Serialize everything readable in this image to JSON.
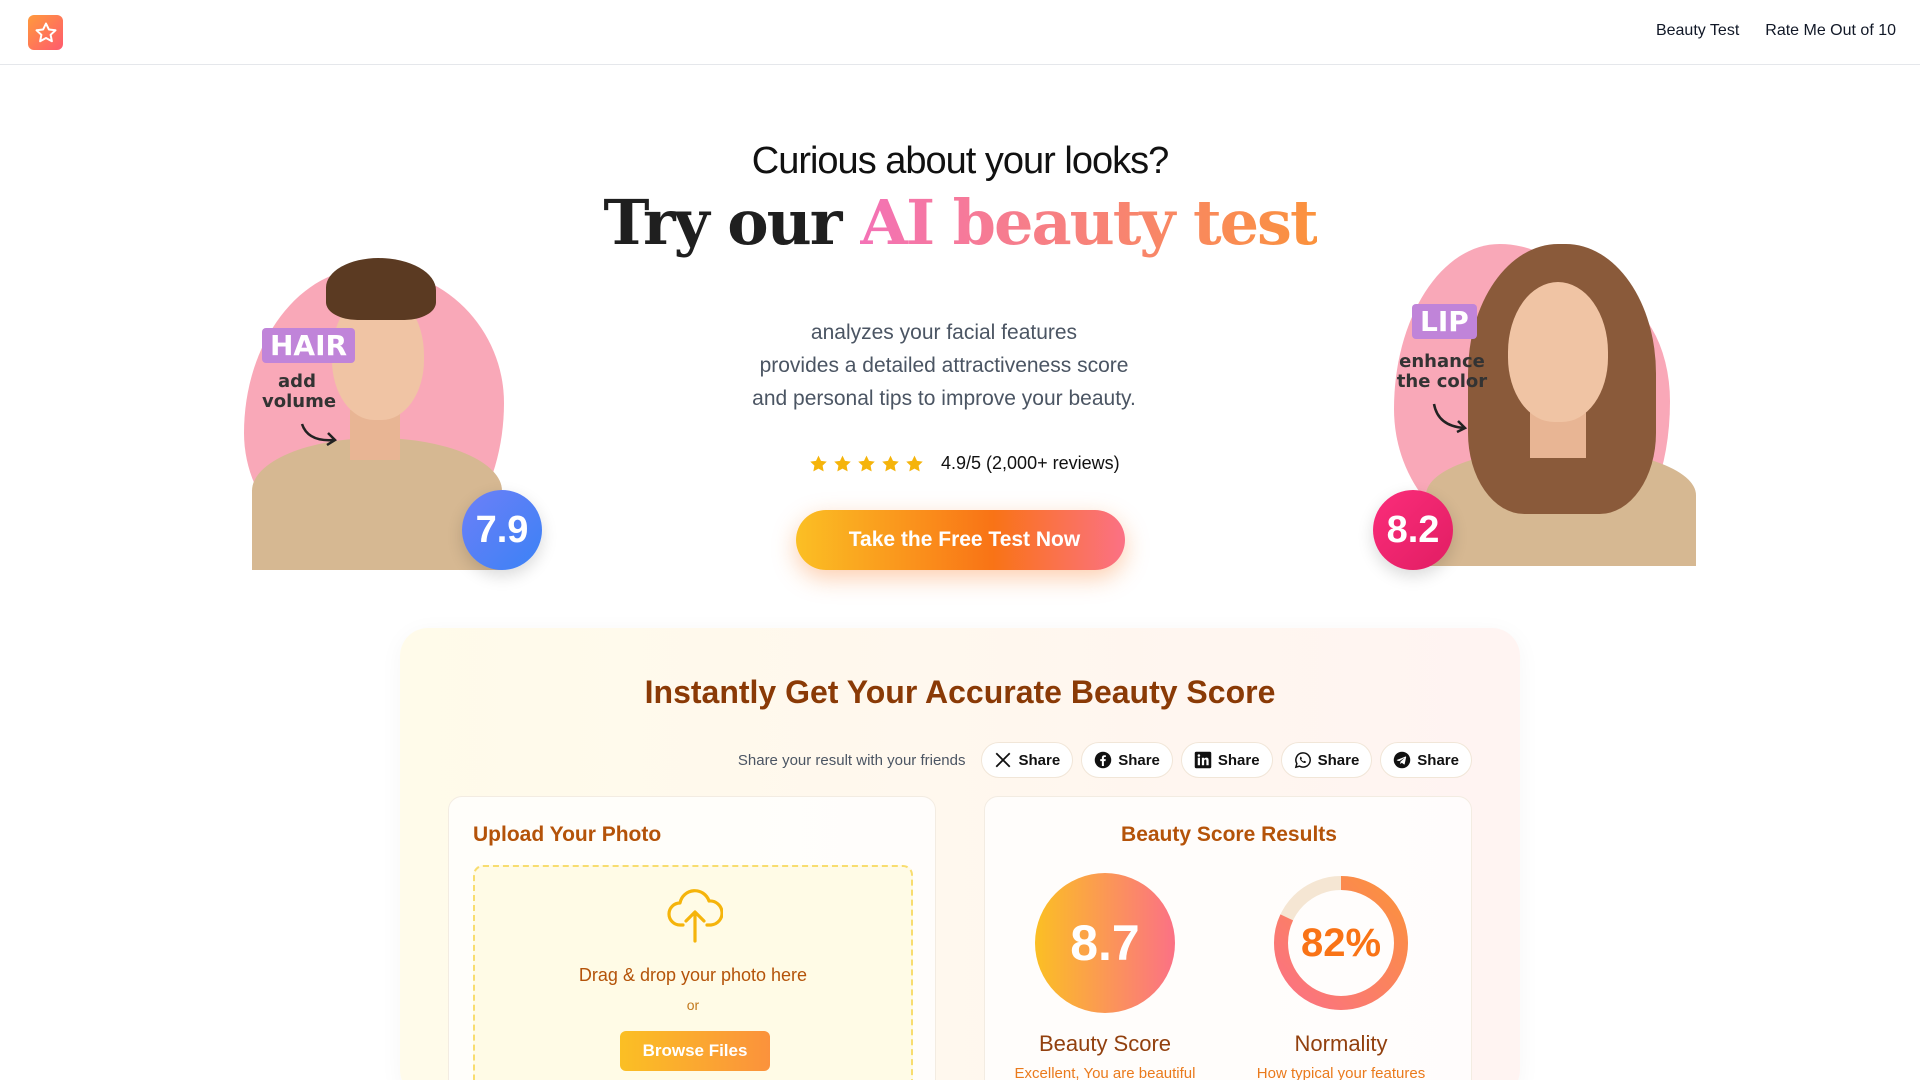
{
  "header": {
    "logo_icon": "star-icon",
    "nav": [
      {
        "label": "Beauty Test"
      },
      {
        "label": "Rate Me Out of 10"
      }
    ]
  },
  "hero": {
    "subtitle": "Curious about your looks?",
    "title_plain": "Try our",
    "title_highlight": "AI beauty test",
    "description_lines": [
      "analyzes your facial features",
      "provides a detailed attractiveness score",
      "and personal tips to improve your beauty."
    ],
    "rating": {
      "stars": 5,
      "text": "4.9/5 (2,000+ reviews)"
    },
    "cta_label": "Take the Free Test Now",
    "cta_icon_glyph": "",
    "left_example": {
      "tag": "HAIR",
      "note_line1": "add",
      "note_line2": "volume",
      "score": "7.9"
    },
    "right_example": {
      "tag": "LIP",
      "note_line1": "enhance",
      "note_line2": "the color",
      "score": "8.2"
    }
  },
  "tool": {
    "title": "Instantly Get Your Accurate Beauty Score",
    "share": {
      "label": "Share your result with your friends",
      "buttons": [
        {
          "icon": "x-icon",
          "label": "Share"
        },
        {
          "icon": "facebook-icon",
          "label": "Share"
        },
        {
          "icon": "linkedin-icon",
          "label": "Share"
        },
        {
          "icon": "whatsapp-icon",
          "label": "Share"
        },
        {
          "icon": "telegram-icon",
          "label": "Share"
        }
      ]
    },
    "upload": {
      "title": "Upload Your Photo",
      "icon": "cloud-upload-icon",
      "drop_text": "Drag & drop your photo here",
      "or_text": "or",
      "browse_label": "Browse Files"
    },
    "results": {
      "title": "Beauty Score Results",
      "beauty_score": {
        "value": "8.7",
        "label": "Beauty Score",
        "desc": "Excellent, You are beautiful"
      },
      "normality": {
        "value": "82%",
        "percent": 82,
        "label": "Normality",
        "desc": "How typical your features"
      }
    }
  },
  "colors": {
    "accent_orange": "#f97316",
    "accent_yellow": "#fbbf24",
    "accent_pink": "#fb7185",
    "title_brown": "#8a3a06"
  }
}
